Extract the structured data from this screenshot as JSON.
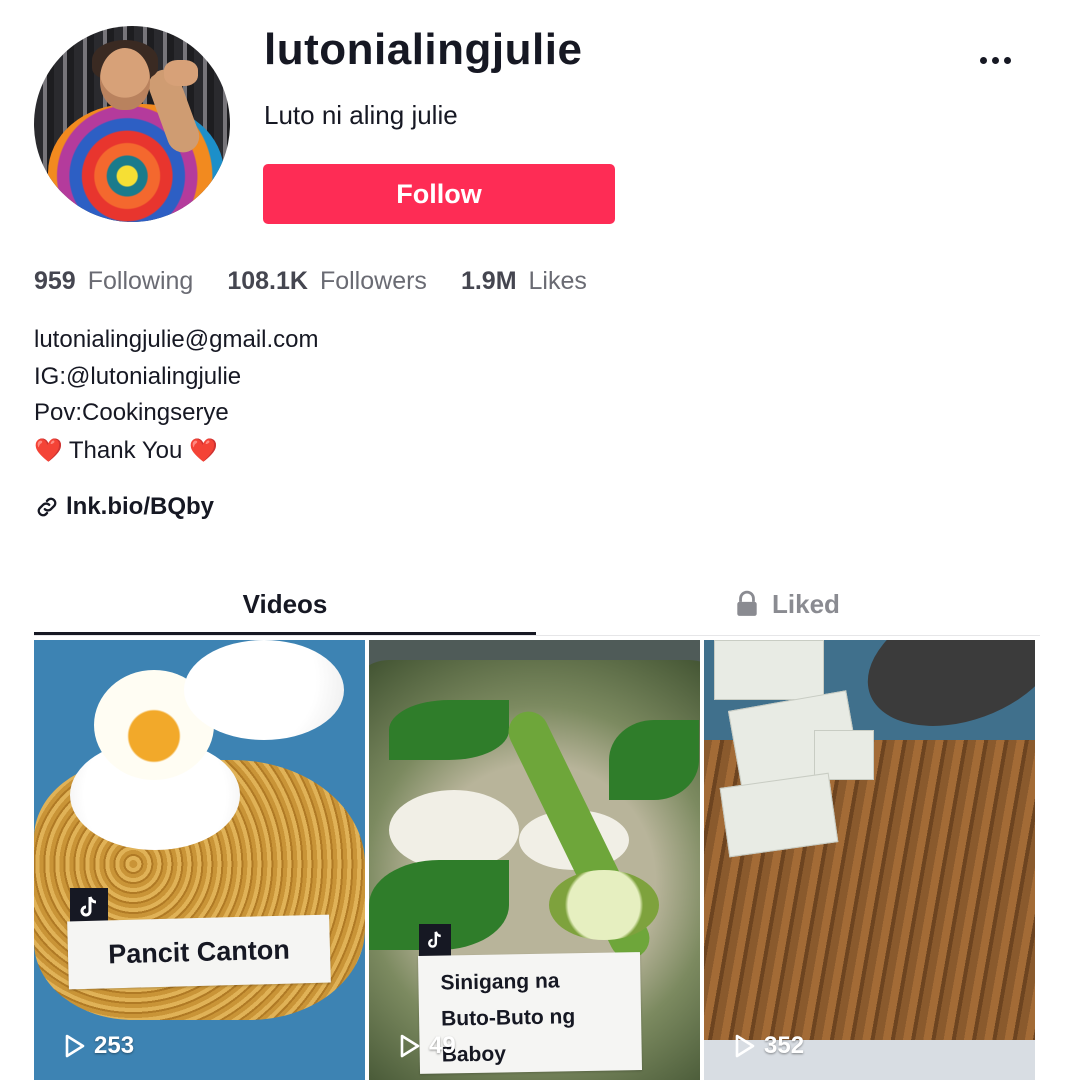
{
  "profile": {
    "username": "lutonialingjulie",
    "nickname": "Luto ni aling julie",
    "follow_label": "Follow"
  },
  "stats": [
    {
      "value": "959",
      "label": "Following"
    },
    {
      "value": "108.1K",
      "label": "Followers"
    },
    {
      "value": "1.9M",
      "label": "Likes"
    }
  ],
  "bio": {
    "email": "lutonialingjulie@gmail.com",
    "ig": "IG:@lutonialingjulie",
    "pov": "Pov:Cookingserye",
    "thanks": "Thank You",
    "heart": "❤️"
  },
  "link": {
    "text": "lnk.bio/BQby",
    "icon": "link-icon"
  },
  "tabs": [
    {
      "label": "Videos",
      "active": true
    },
    {
      "label": "Liked",
      "active": false,
      "icon": "lock-icon"
    }
  ],
  "videos": [
    {
      "caption": "Pancit Canton",
      "views": "253"
    },
    {
      "caption_line1": "Sinigang na",
      "caption_line2": "Buto-Buto ng",
      "caption_line3": "Baboy",
      "views": "49"
    },
    {
      "views": "352"
    }
  ],
  "colors": {
    "accent": "#fe2c55",
    "text": "#161823",
    "muted": "#8a8b91"
  }
}
